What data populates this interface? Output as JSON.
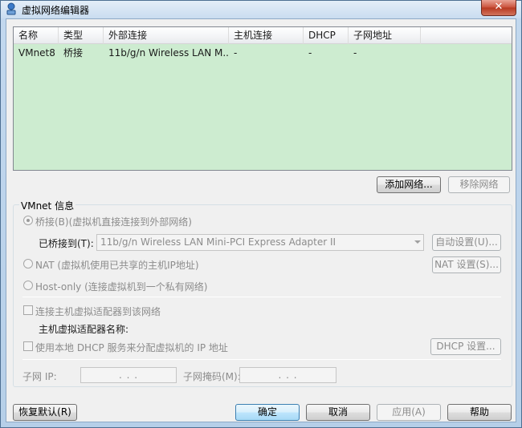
{
  "window": {
    "title": "虚拟网络编辑器",
    "close_label": "✕"
  },
  "listview": {
    "columns": [
      "名称",
      "类型",
      "外部连接",
      "主机连接",
      "DHCP",
      "子网地址"
    ],
    "rows": [
      [
        "VMnet8",
        "桥接",
        "11b/g/n  Wireless LAN M...",
        "-",
        "-",
        "-"
      ]
    ],
    "bg_color": "#cdecd0"
  },
  "list_buttons": {
    "add": "添加网络...",
    "remove": "移除网络"
  },
  "vmnet_info": {
    "group_title": "VMnet 信息",
    "bridged_label": "桥接(B)(虚拟机直接连接到外部网络)",
    "bridged_to_label": "已桥接到(T):",
    "bridged_to_value": "11b/g/n  Wireless LAN Mini-PCI Express Adapter II",
    "auto_settings": "自动设置(U)...",
    "nat_label": "NAT (虚拟机使用已共享的主机IP地址)",
    "nat_settings": "NAT 设置(S)...",
    "hostonly_label": "Host-only (连接虚拟机到一个私有网络)",
    "connect_adapter_label": "连接主机虚拟适配器到该网络",
    "adapter_name_label": "主机虚拟适配器名称:",
    "dhcp_label": "使用本地 DHCP 服务来分配虚拟机的 IP 地址",
    "dhcp_settings": "DHCP 设置...",
    "subnet_ip_label": "子网 IP:",
    "subnet_ip_value": ".    .    .",
    "subnet_mask_label": "子网掩码(M):",
    "subnet_mask_value": ".    .    ."
  },
  "footer": {
    "restore": "恢复默认(R)",
    "ok": "确定",
    "cancel": "取消",
    "apply": "应用(A)",
    "help": "帮助"
  }
}
